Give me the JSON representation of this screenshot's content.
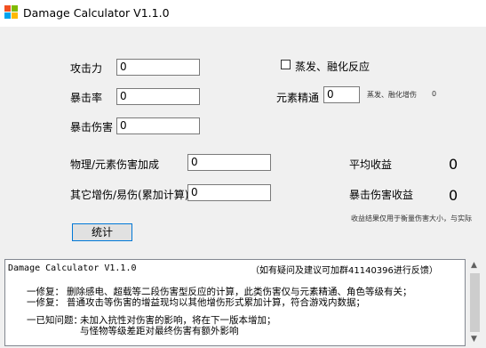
{
  "window": {
    "title": "Damage Calculator V1.1.0"
  },
  "fields": {
    "attack": {
      "label": "攻击力",
      "value": "0"
    },
    "crit_rate": {
      "label": "暴击率",
      "value": "0"
    },
    "crit_damage": {
      "label": "暴击伤害",
      "value": "0"
    },
    "phys_elem_bonus": {
      "label": "物理/元素伤害加成",
      "value": "0"
    },
    "other_bonus": {
      "label": "其它增伤/易伤(累加计算)",
      "value": "0"
    },
    "elemental_mastery": {
      "label": "元素精通",
      "value": "0"
    }
  },
  "reaction": {
    "checkbox_label": "蒸发、融化反应",
    "checked": false,
    "bonus_label": "蒸发、融化增伤",
    "bonus_value": "0"
  },
  "results": {
    "avg_label": "平均收益",
    "avg_value": "0",
    "crit_label": "暴击伤害收益",
    "crit_value": "0",
    "note": "收益结果仅用于衡量伤害大小，与实际"
  },
  "buttons": {
    "calculate": "统计"
  },
  "log": {
    "header_app": "Damage Calculator V1.1.0",
    "header_feedback": "（如有疑问及建议可加群41140396进行反馈）",
    "fix1_title": "一修复：",
    "fix1_line1": "删除感电、超载等二段伤害型反应的计算，此类伤害仅与元素精通、角色等级有关；",
    "fix2_title": "一修复：",
    "fix2_line1": "普通攻击等伤害的增益现均以其他增伤形式累加计算，符合游戏内数据；",
    "issue_title": "一已知问题：",
    "issue_line1": "未加入抗性对伤害的影响，将在下一版本增加；",
    "issue_line2": "与怪物等级差距对最终伤害有额外影响"
  }
}
